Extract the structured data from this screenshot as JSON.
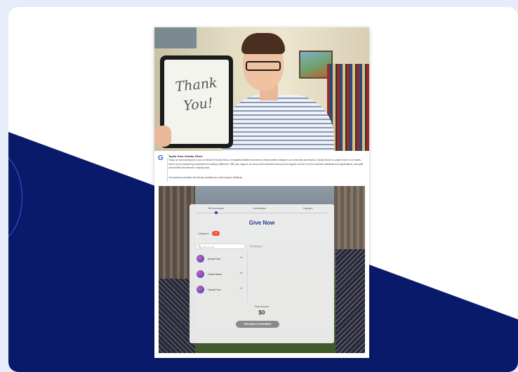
{
  "video": {
    "note_line1": "Thank",
    "note_line2": "You!"
  },
  "message": {
    "title": "Taylor from Gravity Gives",
    "body": "Today, we are reaching out to you on behalf of Gravity Gives, an impactful initiative that aims to create positive change in our community and beyond. Gravity Gives is a project close to our hearts, driven by our unwavering commitment to making a difference. With your support, we can provide essential resources and support to those in need, empower individuals and organizations, and uplift communities that deserve a helping hand.",
    "footer": "Your generous donation will directly contribute to a wide range of initiatives."
  },
  "steps": [
    "Gift Information",
    "Confirmation",
    "Payment"
  ],
  "widget": {
    "title": "Give Now",
    "categories_label": "Categories",
    "categories_count": "All",
    "search_placeholder": "Search funds",
    "giving_to_label": "I'm giving to:",
    "funds": [
      {
        "label": "Annual Fund"
      },
      {
        "label": "Critical Needs"
      },
      {
        "label": "Faculty Fund"
      }
    ],
    "total_label": "Total Amount",
    "total_value": "$0",
    "proceed_label": "PROCEED TO PAYMENT"
  },
  "colors": {
    "navy": "#0a1a6b",
    "accent_blue": "#233a8a",
    "badge_red": "#e8553a",
    "page_bg": "#e6ecfa"
  }
}
